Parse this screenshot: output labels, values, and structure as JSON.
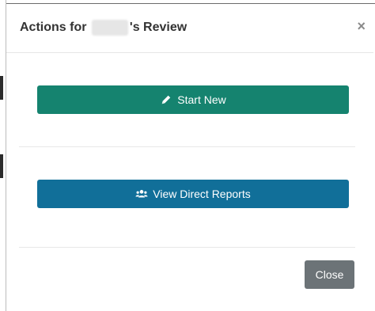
{
  "modal": {
    "title_prefix": "Actions for",
    "title_suffix": "'s Review",
    "close_symbol": "×"
  },
  "actions": {
    "start_new": {
      "label": "Start New",
      "icon": "pencil-icon",
      "color": "#15836f"
    },
    "view_reports": {
      "label": "View Direct Reports",
      "icon": "users-icon",
      "color": "#116f99"
    }
  },
  "footer": {
    "close_label": "Close",
    "close_color": "#6c7377"
  }
}
